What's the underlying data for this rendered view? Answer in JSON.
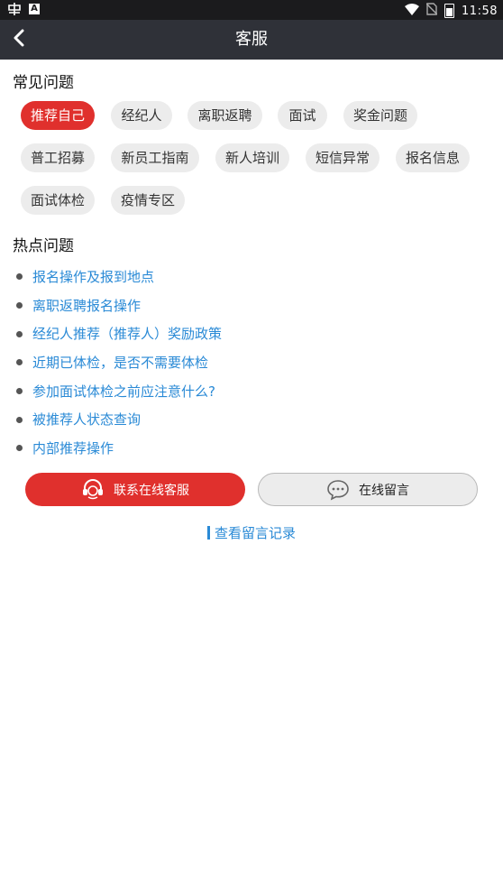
{
  "status_bar": {
    "time": "11:58",
    "icons": [
      "app-icon",
      "a-badge-icon",
      "wifi-icon",
      "no-sim-icon",
      "battery-icon"
    ]
  },
  "header": {
    "title": "客服",
    "back_icon": "chevron-left-icon"
  },
  "faq": {
    "heading": "常见问题",
    "tags": [
      {
        "label": "推荐自己",
        "active": true
      },
      {
        "label": "经纪人",
        "active": false
      },
      {
        "label": "离职返聘",
        "active": false
      },
      {
        "label": "面试",
        "active": false
      },
      {
        "label": "奖金问题",
        "active": false
      },
      {
        "label": "普工招募",
        "active": false
      },
      {
        "label": "新员工指南",
        "active": false
      },
      {
        "label": "新人培训",
        "active": false
      },
      {
        "label": "短信异常",
        "active": false
      },
      {
        "label": "报名信息",
        "active": false
      },
      {
        "label": "面试体检",
        "active": false
      },
      {
        "label": "疫情专区",
        "active": false
      }
    ]
  },
  "hot": {
    "heading": "热点问题",
    "items": [
      "报名操作及报到地点",
      "离职返聘报名操作",
      "经纪人推荐（推荐人）奖励政策",
      "近期已体检，是否不需要体检",
      "参加面试体检之前应注意什么?",
      "被推荐人状态查询",
      "内部推荐操作"
    ]
  },
  "actions": {
    "online_service_label": "联系在线客服",
    "online_service_icon": "headset-icon",
    "message_label": "在线留言",
    "message_icon": "chat-bubble-icon",
    "record_link_label": "查看留言记录"
  },
  "colors": {
    "accent_red": "#e0302d",
    "link_blue": "#2a8ad6",
    "header_bg": "#2f3138",
    "tag_bg": "#ececec"
  }
}
